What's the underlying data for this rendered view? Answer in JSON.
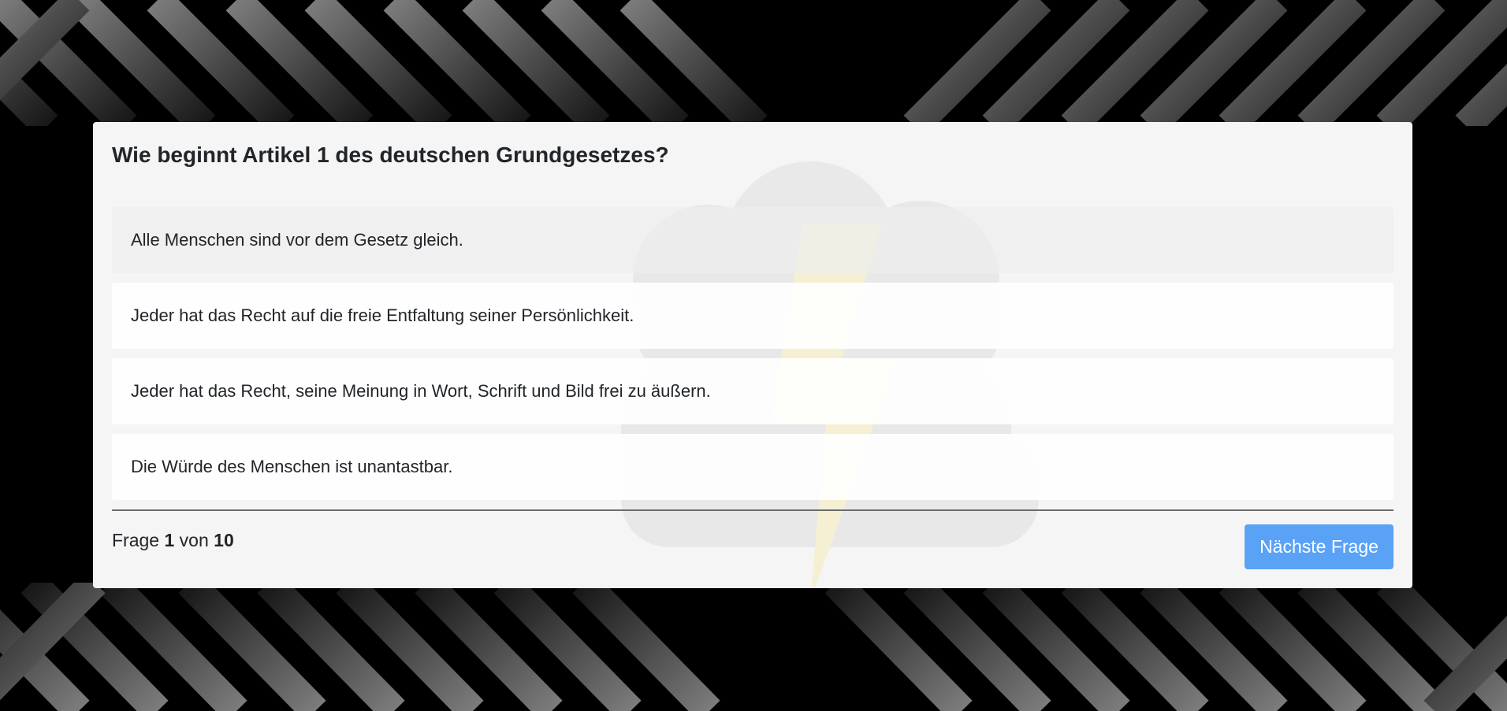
{
  "quiz": {
    "question": "Wie beginnt Artikel 1 des deutschen Grundgesetzes?",
    "answers": [
      {
        "text": "Alle Menschen sind vor dem Gesetz gleich."
      },
      {
        "text": "Jeder hat das Recht auf die freie Entfaltung seiner Persönlichkeit."
      },
      {
        "text": "Jeder hat das Recht, seine Meinung in Wort, Schrift und Bild frei zu äußern."
      },
      {
        "text": "Die Würde des Menschen ist unantastbar."
      }
    ],
    "progress": {
      "label_prefix": "Frage",
      "current": "1",
      "label_middle": "von",
      "total": "10"
    },
    "next_button_label": "Nächste Frage"
  },
  "colors": {
    "page_background": "#000000",
    "card_background": "#f5f5f5",
    "button_background": "#5aa2f6",
    "text": "#212529"
  },
  "icons": {
    "watermark": "storm-cloud-lightning-icon"
  }
}
